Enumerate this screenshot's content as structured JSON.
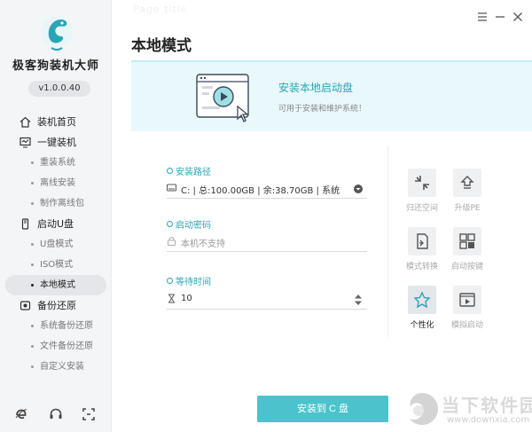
{
  "app": {
    "name": "极客狗装机大师",
    "version": "v1.0.0.40"
  },
  "sidebar": {
    "items": [
      {
        "label": "装机首页",
        "icon": "home-icon",
        "type": "main"
      },
      {
        "label": "一键装机",
        "icon": "monitor-icon",
        "type": "main"
      },
      {
        "label": "重装系统",
        "type": "sub"
      },
      {
        "label": "离线安装",
        "type": "sub"
      },
      {
        "label": "制作离线包",
        "type": "sub"
      },
      {
        "label": "启动U盘",
        "icon": "usb-icon",
        "type": "main"
      },
      {
        "label": "U盘模式",
        "type": "sub"
      },
      {
        "label": "ISO模式",
        "type": "sub"
      },
      {
        "label": "本地模式",
        "type": "sub",
        "active": true
      },
      {
        "label": "备份还原",
        "icon": "backup-icon",
        "type": "main"
      },
      {
        "label": "系统备份还原",
        "type": "sub"
      },
      {
        "label": "文件备份还原",
        "type": "sub"
      },
      {
        "label": "自定义安装",
        "type": "sub"
      }
    ],
    "bottom_icons": [
      "ie-browser-icon",
      "headset-icon",
      "fullscreen-icon"
    ]
  },
  "header": {
    "ghost_title": "Page title",
    "title": "本地模式"
  },
  "banner": {
    "title": "安装本地启动盘",
    "subtitle": "可用于安装和维护系统！"
  },
  "install_path": {
    "label": "安装路径",
    "value": "C: | 总:100.00GB | 余:38.70GB | 系统"
  },
  "boot_password": {
    "label": "启动密码",
    "placeholder": "本机不支持"
  },
  "wait_time": {
    "label": "等待时间",
    "value": "10"
  },
  "tools": [
    {
      "label": "归还空间",
      "icon": "shrink-icon"
    },
    {
      "label": "升级PE",
      "icon": "upgrade-icon"
    },
    {
      "label": "模式转换",
      "icon": "convert-icon"
    },
    {
      "label": "启动按键",
      "icon": "boot-key-icon"
    },
    {
      "label": "个性化",
      "icon": "personalize-icon",
      "active": true
    },
    {
      "label": "模拟启动",
      "icon": "simulate-boot-icon"
    }
  ],
  "install_button": "安装到 C 盘",
  "watermark": {
    "name": "当下软件园",
    "url": "www.downxia.com"
  },
  "colors": {
    "accent": "#4cc3cc",
    "accent_text": "#2aa5b5",
    "banner_bg": "#e9f8fb",
    "sidebar_bg": "#f4f5f7"
  }
}
